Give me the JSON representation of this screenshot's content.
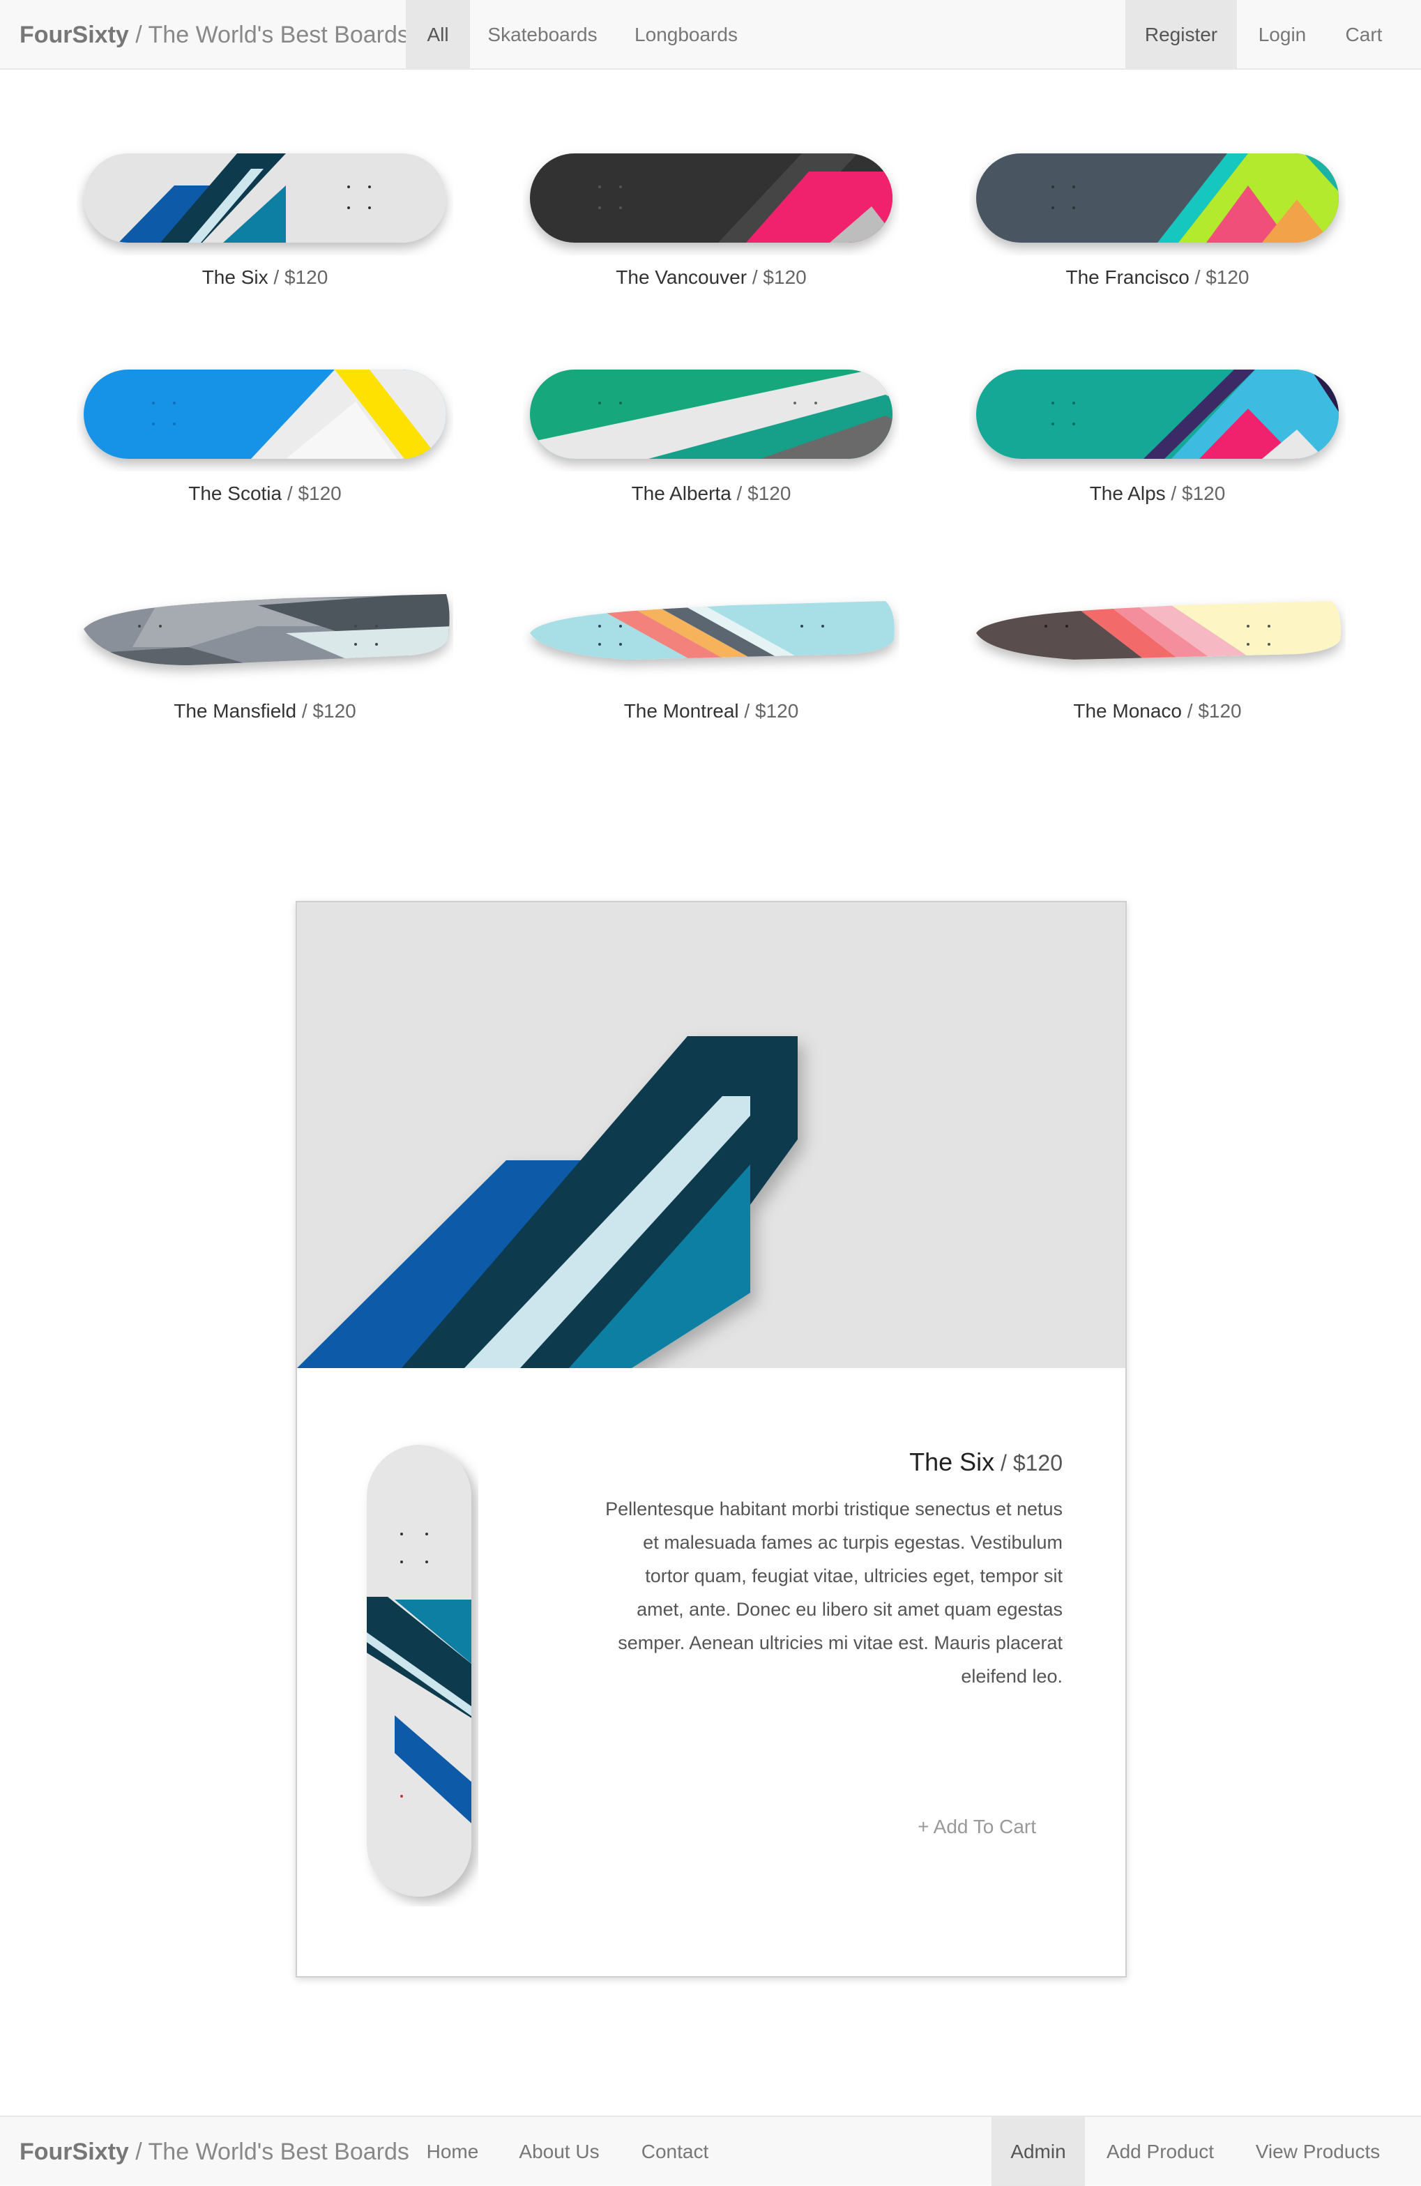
{
  "header": {
    "brand_name": "FourSixty",
    "brand_tagline": " / The World's Best Boards",
    "nav": [
      "All",
      "Skateboards",
      "Longboards"
    ],
    "nav_right": [
      "Register",
      "Login",
      "Cart"
    ]
  },
  "products": [
    {
      "name": "The Six",
      "price": "$120"
    },
    {
      "name": "The Vancouver",
      "price": "$120"
    },
    {
      "name": "The Francisco",
      "price": "$120"
    },
    {
      "name": "The Scotia",
      "price": "$120"
    },
    {
      "name": "The Alberta",
      "price": "$120"
    },
    {
      "name": "The Alps",
      "price": "$120"
    },
    {
      "name": "The Mansfield",
      "price": "$120"
    },
    {
      "name": "The Montreal",
      "price": "$120"
    },
    {
      "name": "The Monaco",
      "price": "$120"
    }
  ],
  "separator": " / ",
  "detail": {
    "name": "The Six",
    "price": "$120",
    "description": "Pellentesque habitant morbi tristique senectus et netus et malesuada fames ac turpis egestas. Vestibulum tortor quam, feugiat vitae, ultricies eget, tempor sit amet, ante. Donec eu libero sit amet quam egestas semper. Aenean ultricies mi vitae est. Mauris placerat eleifend leo.",
    "add_to_cart": "+ Add To Cart"
  },
  "footer": {
    "brand_name": "FourSixty",
    "brand_tagline": " / The World's Best Boards",
    "nav": [
      "Home",
      "About Us",
      "Contact"
    ],
    "nav_right": [
      "Admin",
      "Add Product",
      "View Products"
    ]
  },
  "colors": {
    "navbar_bg": "#f8f8f8",
    "active_nav_bg": "#e7e7e7",
    "six_blue": "#0a5aa8",
    "six_navy": "#0f3a4e",
    "six_teal": "#0a7fa3"
  }
}
